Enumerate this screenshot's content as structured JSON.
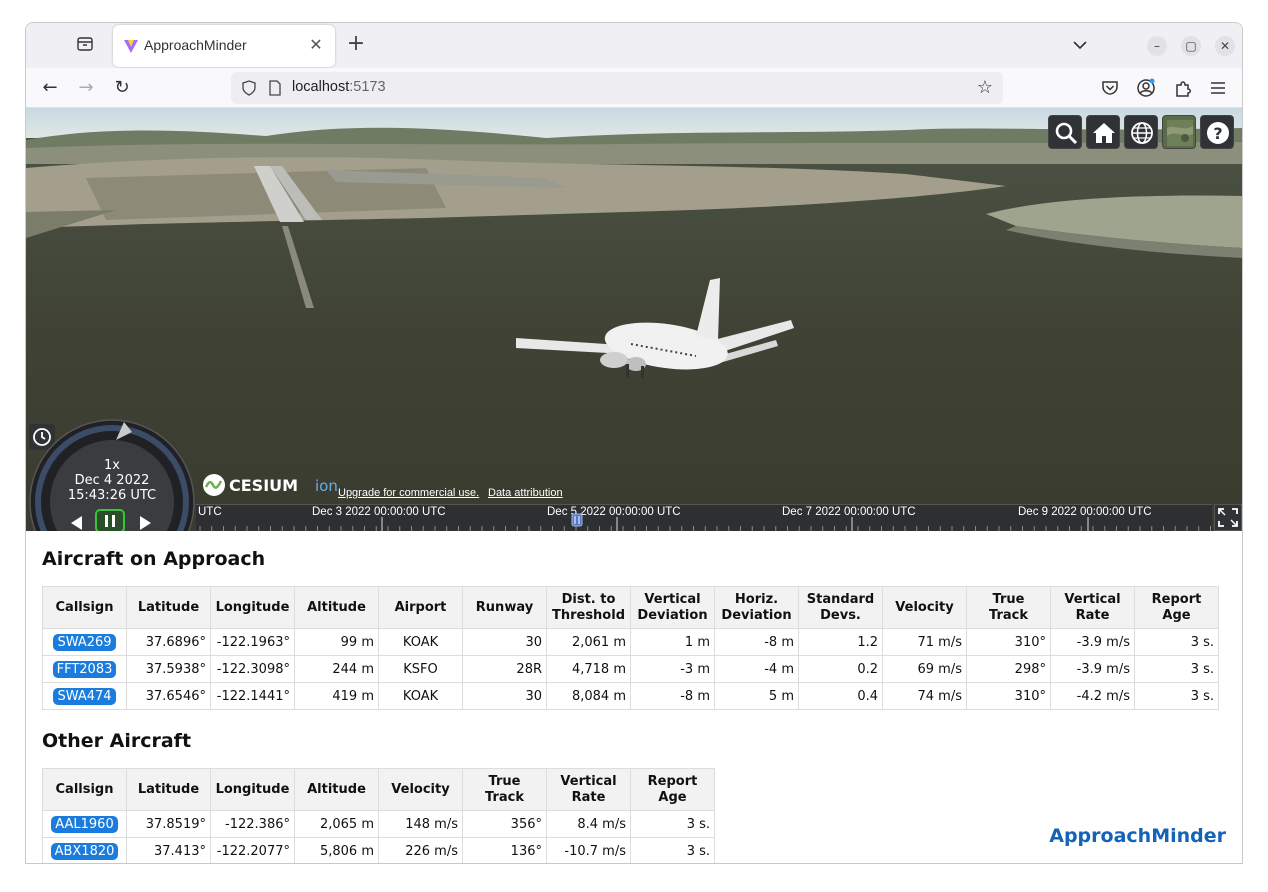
{
  "browser": {
    "tab_title": "ApproachMinder",
    "url_host": "localhost",
    "url_port": ":5173"
  },
  "viewer": {
    "animation": {
      "speed": "1x",
      "date": "Dec 4 2022",
      "time": "15:43:26 UTC"
    },
    "credits": {
      "upgrade": "Upgrade for commercial use.",
      "attribution": "Data attribution"
    },
    "timeline_labels": [
      "UTC",
      "Dec 3 2022 00:00:00 UTC",
      "Dec 5 2022 00:00:00 UTC",
      "Dec 7 2022 00:00:00 UTC",
      "Dec 9 2022 00:00:00 UTC"
    ]
  },
  "approach": {
    "title": "Aircraft on Approach",
    "headers": [
      "Callsign",
      "Latitude",
      "Longitude",
      "Altitude",
      "Airport",
      "Runway",
      "Dist. to Threshold",
      "Vertical Deviation",
      "Horiz. Deviation",
      "Standard Devs.",
      "Velocity",
      "True Track",
      "Vertical Rate",
      "Report Age"
    ],
    "rows": [
      [
        "SWA269",
        "37.6896°",
        "-122.1963°",
        "99 m",
        "KOAK",
        "30",
        "2,061 m",
        "1 m",
        "-8 m",
        "1.2",
        "71 m/s",
        "310°",
        "-3.9 m/s",
        "3 s."
      ],
      [
        "FFT2083",
        "37.5938°",
        "-122.3098°",
        "244 m",
        "KSFO",
        "28R",
        "4,718 m",
        "-3 m",
        "-4 m",
        "0.2",
        "69 m/s",
        "298°",
        "-3.9 m/s",
        "3 s."
      ],
      [
        "SWA474",
        "37.6546°",
        "-122.1441°",
        "419 m",
        "KOAK",
        "30",
        "8,084 m",
        "-8 m",
        "5 m",
        "0.4",
        "74 m/s",
        "310°",
        "-4.2 m/s",
        "3 s."
      ]
    ]
  },
  "other": {
    "title": "Other Aircraft",
    "headers": [
      "Callsign",
      "Latitude",
      "Longitude",
      "Altitude",
      "Velocity",
      "True Track",
      "Vertical Rate",
      "Report Age"
    ],
    "rows": [
      [
        "AAL1960",
        "37.8519°",
        "-122.386°",
        "2,065 m",
        "148 m/s",
        "356°",
        "8.4 m/s",
        "3 s."
      ],
      [
        "ABX1820",
        "37.413°",
        "-122.2077°",
        "5,806 m",
        "226 m/s",
        "136°",
        "-10.7 m/s",
        "3 s."
      ]
    ]
  },
  "brand": "ApproachMinder",
  "colors": {
    "callsign_badge": "#1a7dde",
    "brand": "#1463b8",
    "cesium_panel": "#303336"
  }
}
